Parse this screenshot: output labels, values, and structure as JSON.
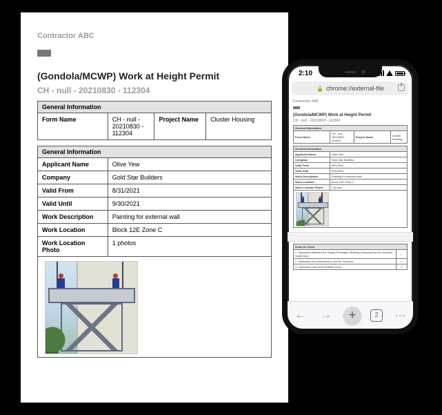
{
  "doc": {
    "contractor": "Contractor ABC",
    "title": "(Gondola/MCWP) Work at Height Permit",
    "subtitle": "CH - null - 20210830 - 112304",
    "section1": "General Information",
    "table1": {
      "h1": "Form Name",
      "v1": "CH - null - 20210830 - 112304",
      "h2": "Project Name",
      "v2": "Cluster Housing"
    },
    "section2": "General Information",
    "rows": {
      "r1": {
        "label": "Applicant Name",
        "value": "Olive Yew"
      },
      "r2": {
        "label": "Company",
        "value": "Gold Star Builders"
      },
      "r3": {
        "label": "Valid From",
        "value": "8/31/2021"
      },
      "r4": {
        "label": "Valid Until",
        "value": "9/30/2021"
      },
      "r5": {
        "label": "Work Description",
        "value": "Painting for external wall"
      },
      "r6": {
        "label": "Work Location",
        "value": "Block 12E Zone C"
      },
      "r7": {
        "label": "Work Location Photo",
        "value": "1 photos"
      }
    }
  },
  "phone": {
    "time": "2:10",
    "url_prefix": "🔒",
    "url": "chrome://external-file",
    "items_section": "Items to Check",
    "items": {
      "i1": {
        "text": "1. Operators attended the Safety Orientation Briefing conducted by the Gondola Supervisor.",
        "check": "✓"
      },
      "i2": {
        "text": "2. Operators are authorized to use the Gondola",
        "check": "✓"
      },
      "i3": {
        "text": "3. Operators have been briefed on the",
        "check": "✓"
      }
    },
    "tab_count": "2"
  }
}
